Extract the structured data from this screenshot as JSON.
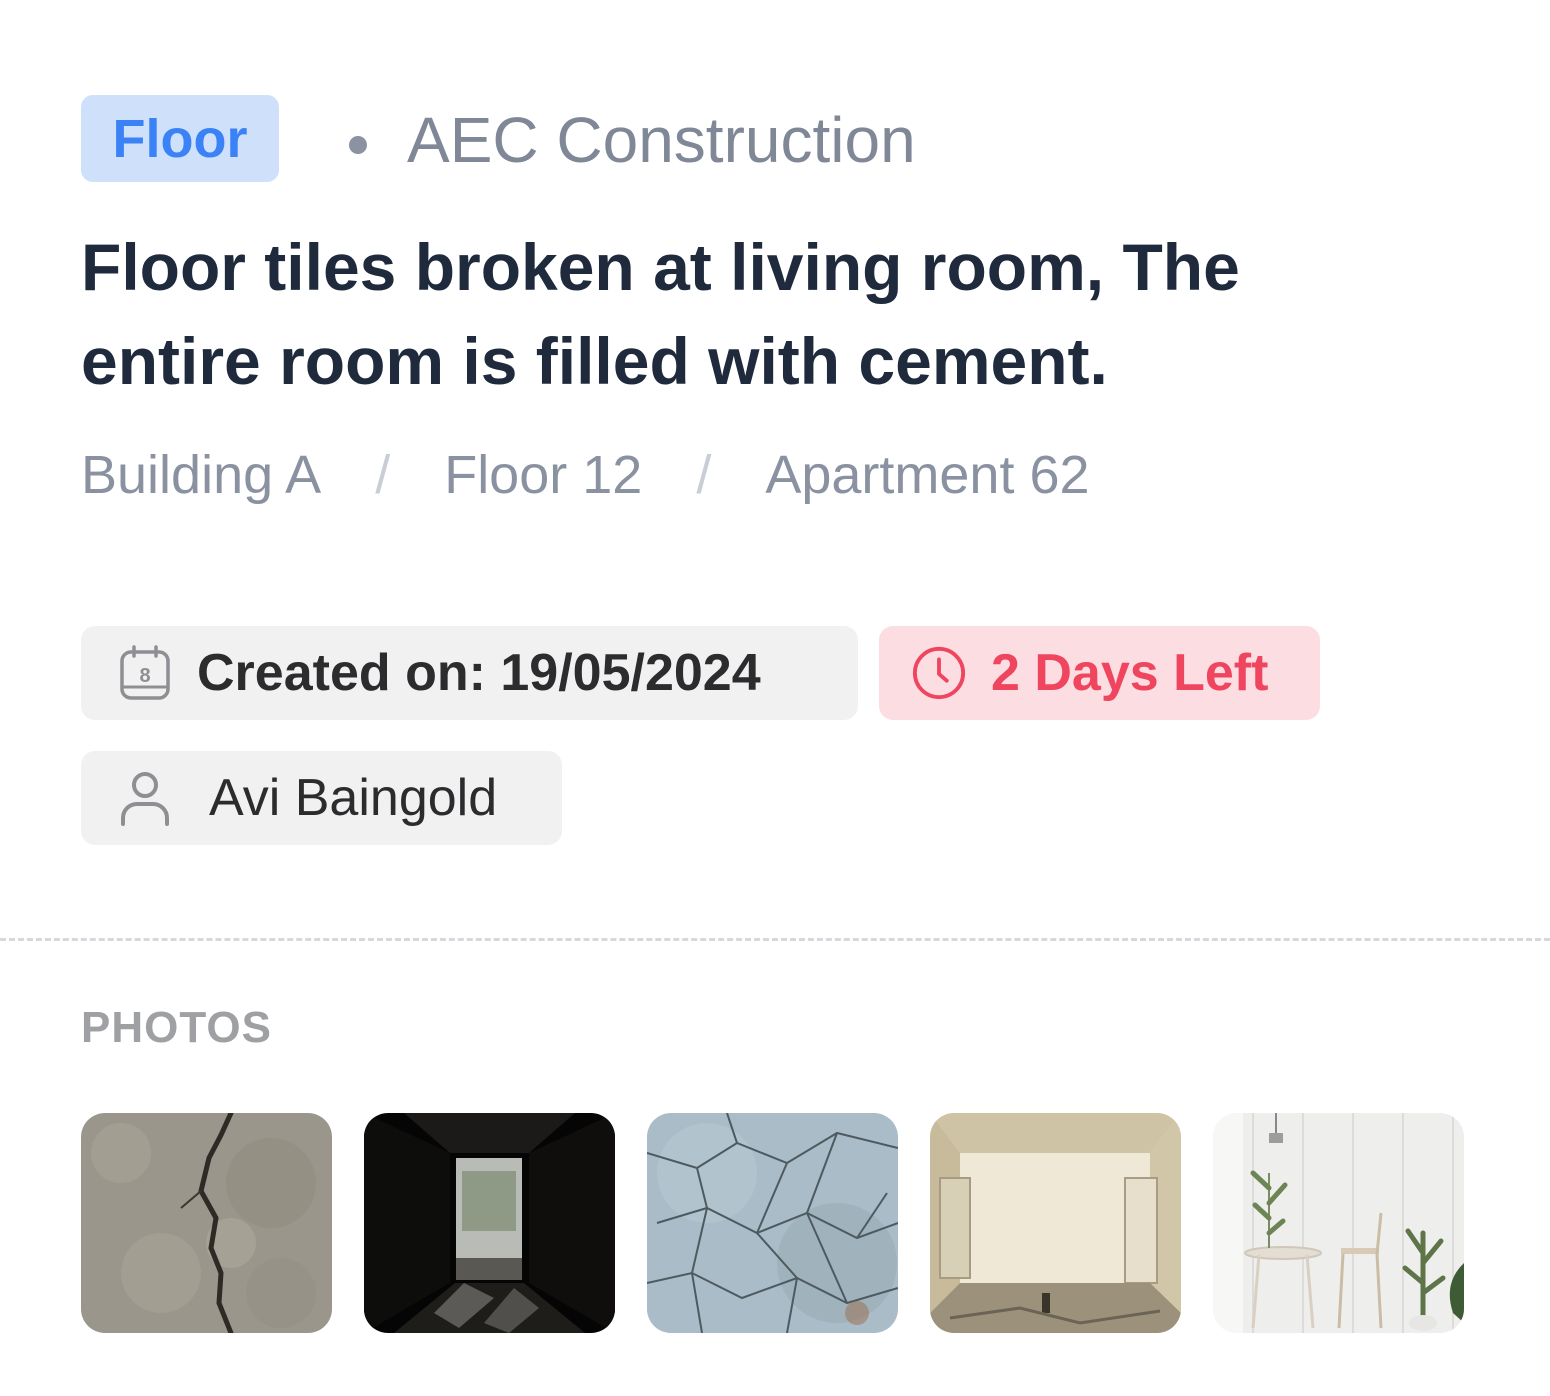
{
  "issue": {
    "category": "Floor",
    "company": "AEC Construction",
    "title": "Floor tiles broken at living room, The entire room is filled with cement.",
    "location": [
      "Building A",
      "Floor 12",
      "Apartment 62"
    ],
    "location_separator": "/",
    "created": "Created on: 19/05/2024",
    "due": "2 Days Left",
    "assignee": "Avi Baingold"
  },
  "photos": {
    "label": "PHOTOS",
    "items": [
      "cracked-concrete",
      "dark-corridor",
      "cracked-tiles",
      "abandoned-room",
      "white-dining-room"
    ]
  },
  "icons": {
    "calendar": "calendar-icon",
    "calendar_day": "8",
    "clock": "clock-icon",
    "user": "user-icon"
  },
  "colors": {
    "tag_bg": "#cfe0fb",
    "tag_text": "#3b82f6",
    "title": "#1f2b3d",
    "muted": "#8a92a1",
    "due_bg": "#fbdde2",
    "due_text": "#f0455f",
    "chip_bg": "#f1f1f2"
  }
}
